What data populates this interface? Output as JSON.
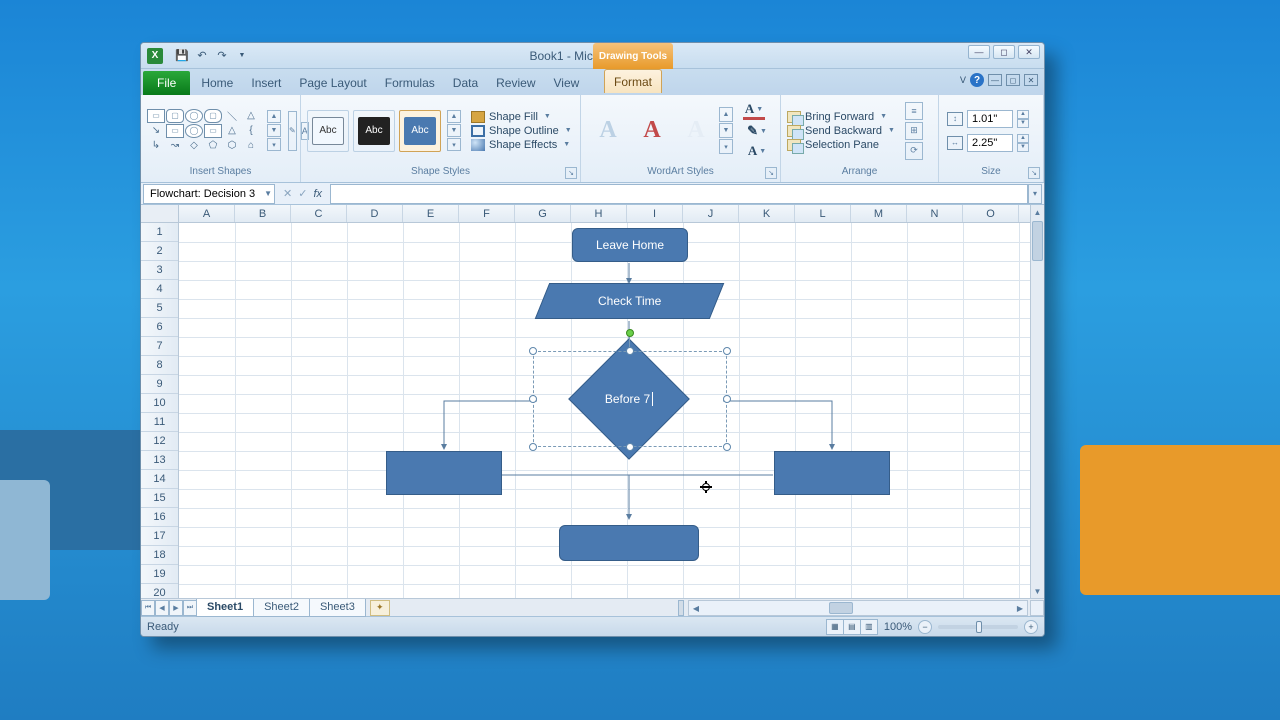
{
  "title": "Book1 - Microsoft Excel",
  "context_tool": "Drawing Tools",
  "tabs": {
    "file": "File",
    "items": [
      "Home",
      "Insert",
      "Page Layout",
      "Formulas",
      "Data",
      "Review",
      "View"
    ],
    "context": "Format"
  },
  "ribbon": {
    "insert_shapes_label": "Insert Shapes",
    "shape_styles_label": "Shape Styles",
    "wordart_label": "WordArt Styles",
    "arrange_label": "Arrange",
    "size_label": "Size",
    "style_swatch_text": "Abc",
    "shape_fill": "Shape Fill",
    "shape_outline": "Shape Outline",
    "shape_effects": "Shape Effects",
    "wa_letter": "A",
    "bring_forward": "Bring Forward",
    "send_backward": "Send Backward",
    "selection_pane": "Selection Pane",
    "height_val": "1.01\"",
    "width_val": "2.25\""
  },
  "name_box": "Flowchart: Decision 3",
  "columns": [
    "A",
    "B",
    "C",
    "D",
    "E",
    "F",
    "G",
    "H",
    "I",
    "J",
    "K",
    "L",
    "M",
    "N",
    "O"
  ],
  "rows": [
    "1",
    "2",
    "3",
    "4",
    "5",
    "6",
    "7",
    "8",
    "9",
    "10",
    "11",
    "12",
    "13",
    "14",
    "15",
    "16",
    "17",
    "18",
    "19",
    "20"
  ],
  "flow": {
    "leave_home": "Leave Home",
    "check_time": "Check Time",
    "before7": "Before 7"
  },
  "sheets": {
    "s1": "Sheet1",
    "s2": "Sheet2",
    "s3": "Sheet3"
  },
  "status": {
    "ready": "Ready",
    "zoom": "100%"
  }
}
